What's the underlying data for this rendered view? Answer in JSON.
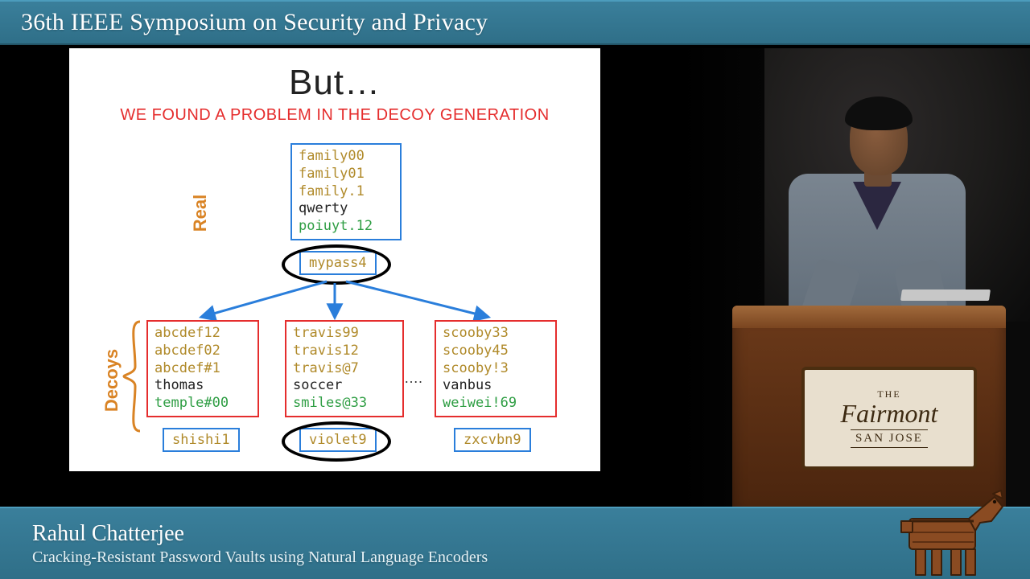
{
  "header": {
    "title": "36th IEEE Symposium on Security and Privacy"
  },
  "footer": {
    "speaker": "Rahul Chatterjee",
    "talk": "Cracking-Resistant Password Vaults using Natural Language Encoders"
  },
  "venue": {
    "the": "THE",
    "hotel": "Fairmont",
    "city": "SAN JOSE"
  },
  "slide": {
    "title": "But…",
    "subtitle": "WE FOUND A PROBLEM IN THE DECOY GENERATION",
    "labels": {
      "real": "Real",
      "decoys": "Decoys"
    },
    "real_box": {
      "rows": [
        {
          "w": "family00",
          "cls": "t-brown"
        },
        {
          "w": "family01",
          "cls": "t-brown"
        },
        {
          "w": "family.1",
          "cls": "t-brown"
        },
        {
          "w": "qwerty",
          "cls": "t-black"
        },
        {
          "w": "poiuyt.12",
          "cls": "t-green"
        }
      ],
      "master": "mypass4"
    },
    "decoys": [
      {
        "rows": [
          {
            "w": "abcdef12",
            "cls": "t-brown"
          },
          {
            "w": "abcdef02",
            "cls": "t-brown"
          },
          {
            "w": "abcdef#1",
            "cls": "t-brown"
          },
          {
            "w": "thomas",
            "cls": "t-black"
          },
          {
            "w": "temple#00",
            "cls": "t-green"
          }
        ],
        "master": "shishi1"
      },
      {
        "rows": [
          {
            "w": "travis99",
            "cls": "t-brown"
          },
          {
            "w": "travis12",
            "cls": "t-brown"
          },
          {
            "w": "travis@7",
            "cls": "t-brown"
          },
          {
            "w": "soccer",
            "cls": "t-black"
          },
          {
            "w": "smiles@33",
            "cls": "t-green"
          }
        ],
        "master": "violet9"
      },
      {
        "rows": [
          {
            "w": "scooby33",
            "cls": "t-brown"
          },
          {
            "w": "scooby45",
            "cls": "t-brown"
          },
          {
            "w": "scooby!3",
            "cls": "t-brown"
          },
          {
            "w": "vanbus",
            "cls": "t-black"
          },
          {
            "w": "weiwei!69",
            "cls": "t-green"
          }
        ],
        "master": "zxcvbn9"
      }
    ],
    "dots": "…."
  },
  "colors": {
    "header_bg": "#357a94",
    "accent_red": "#e52d2d",
    "accent_orange": "#d98324",
    "box_blue": "#2a7edb",
    "box_red": "#e52d2d",
    "text_green": "#2f9e44",
    "text_brown": "#b08a2a"
  }
}
